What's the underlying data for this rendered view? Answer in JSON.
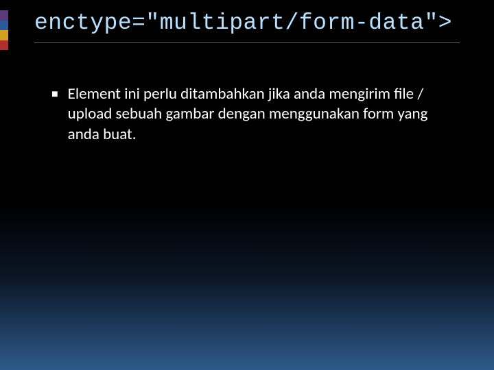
{
  "slide": {
    "title": "enctype=\"multipart/form-data\">",
    "bullets": [
      {
        "text": "Element ini perlu ditambahkan jika anda mengirim file / upload sebuah gambar dengan menggunakan form yang anda buat."
      }
    ],
    "accent_colors": {
      "purple": "#5a3a7a",
      "blue": "#2a5a9a",
      "yellow": "#d4a020",
      "red": "#b03030"
    }
  }
}
